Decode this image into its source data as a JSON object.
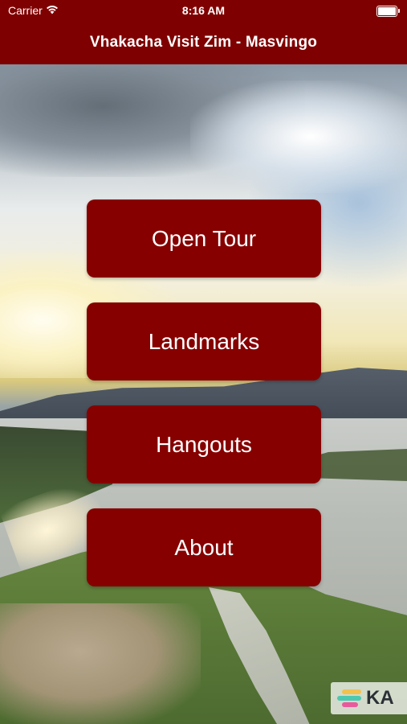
{
  "status_bar": {
    "carrier": "Carrier",
    "time": "8:16 AM"
  },
  "navbar": {
    "title": "Vhakacha Visit Zim - Masvingo"
  },
  "menu": {
    "items": [
      {
        "label": "Open Tour"
      },
      {
        "label": "Landmarks"
      },
      {
        "label": "Hangouts"
      },
      {
        "label": "About"
      }
    ]
  },
  "watermark": {
    "text": "KA",
    "icon": "kapwing-logo",
    "colors": [
      "#f2c14e",
      "#4ec9b0",
      "#e85a9c"
    ]
  },
  "colors": {
    "brand": "#7f0000",
    "button": "#860000",
    "text": "#ffffff"
  },
  "icons": {
    "wifi": "wifi-icon",
    "battery": "battery-icon"
  }
}
